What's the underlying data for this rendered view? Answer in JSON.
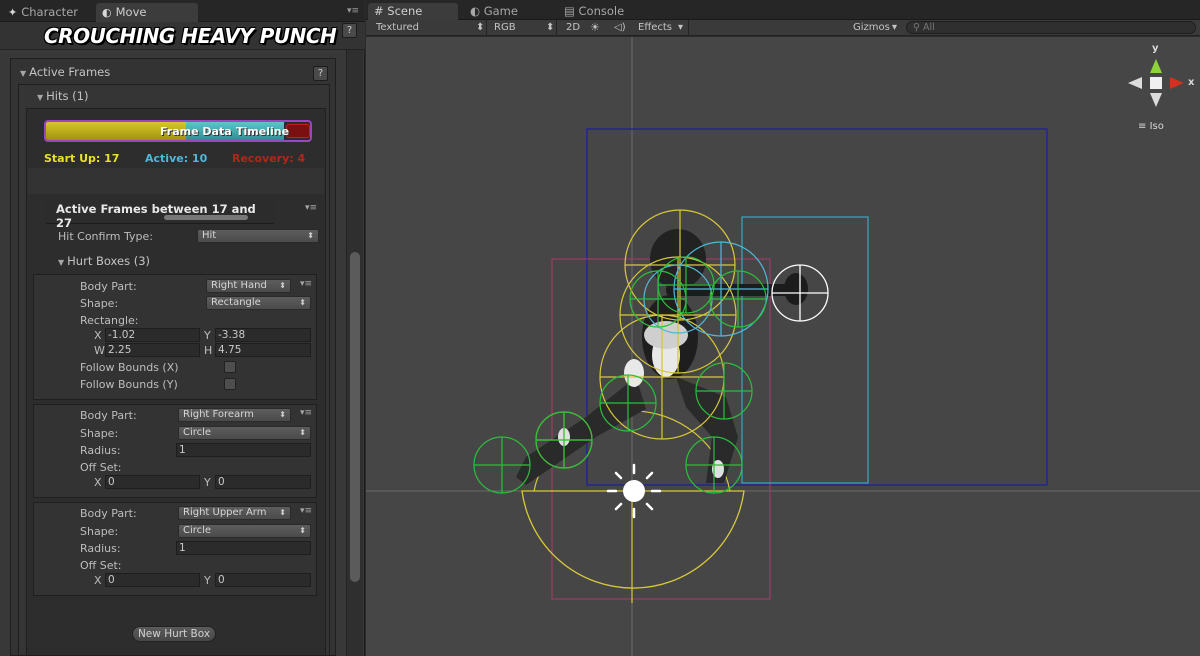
{
  "inspector": {
    "tabs": [
      {
        "label": "Character",
        "icon": "character-icon"
      },
      {
        "label": "Move",
        "icon": "move-icon"
      }
    ],
    "help": "?",
    "move_title": "CROUCHING HEAVY PUNCH",
    "active_frames_label": "Active Frames",
    "hits_label": "Hits (1)",
    "timeline": {
      "frame_data_label": "Frame Data",
      "timeline_label": "Timeline"
    },
    "stats": {
      "startup": "Start Up: 17",
      "active": "Active: 10",
      "recovery": "Recovery: 4"
    },
    "active_frames_between": "Active Frames between 17 and 27",
    "hit_confirm_label": "Hit Confirm Type:",
    "hit_confirm_value": "Hit",
    "hurt_boxes_label": "Hurt Boxes (3)",
    "hurt_boxes": [
      {
        "body_part_label": "Body Part:",
        "body_part": "Right Hand",
        "shape_label": "Shape:",
        "shape": "Rectangle",
        "rect_label": "Rectangle:",
        "x_label": "X",
        "x": "-1.02",
        "y_label": "Y",
        "y": "-3.38",
        "w_label": "W",
        "w": "2.25",
        "h_label": "H",
        "h": "4.75",
        "follow_x": "Follow Bounds (X)",
        "follow_y": "Follow Bounds (Y)"
      },
      {
        "body_part_label": "Body Part:",
        "body_part": "Right Forearm",
        "shape_label": "Shape:",
        "shape": "Circle",
        "radius_label": "Radius:",
        "radius": "1",
        "offset_label": "Off Set:",
        "x_label": "X",
        "x": "0",
        "y_label": "Y",
        "y": "0"
      },
      {
        "body_part_label": "Body Part:",
        "body_part": "Right Upper Arm",
        "shape_label": "Shape:",
        "shape": "Circle",
        "radius_label": "Radius:",
        "radius": "1",
        "offset_label": "Off Set:",
        "x_label": "X",
        "x": "0",
        "y_label": "Y",
        "y": "0"
      }
    ],
    "new_hurt_box": "New Hurt Box"
  },
  "scene": {
    "tabs": [
      {
        "label": "Scene",
        "icon": "grid-icon"
      },
      {
        "label": "Game",
        "icon": "game-icon"
      },
      {
        "label": "Console",
        "icon": "console-icon"
      }
    ],
    "toolbar": {
      "render_mode": "Textured",
      "color_mode": "RGB",
      "mode_2d": "2D",
      "effects": "Effects",
      "gizmos": "Gizmos",
      "search_placeholder": "All"
    },
    "gizmo": {
      "y": "y",
      "x": "x",
      "projection": "Iso"
    }
  },
  "colors": {
    "accent_yellow": "#d7c72a",
    "accent_teal": "#2f8f92",
    "startup": "#e8e02a",
    "active": "#4fb8d8",
    "recovery": "#b0281a"
  }
}
